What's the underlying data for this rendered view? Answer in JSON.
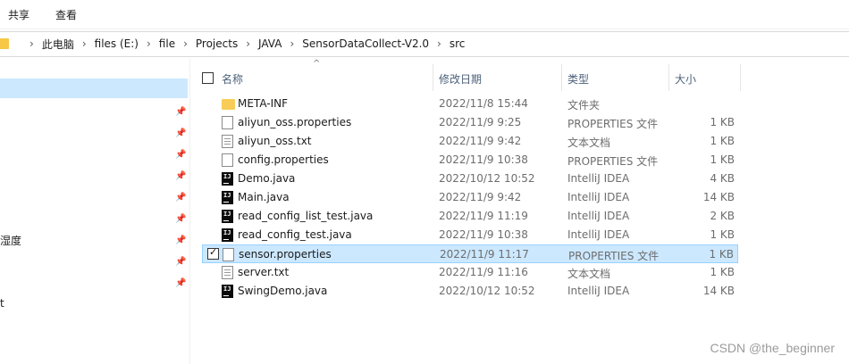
{
  "ribbon": {
    "tabs": [
      {
        "label": "共享"
      },
      {
        "label": "查看"
      }
    ]
  },
  "address": {
    "crumbs": [
      "此电脑",
      "files (E:)",
      "file",
      "Projects",
      "JAVA",
      "SensorDataCollect-V2.0",
      "src"
    ],
    "separator": "›"
  },
  "nav": {
    "labels": [
      {
        "text": "湿度"
      },
      {
        "text": "t"
      }
    ]
  },
  "columns": {
    "name": "名称",
    "date": "修改日期",
    "type": "类型",
    "size": "大小"
  },
  "files": [
    {
      "name": "META-INF",
      "date": "2022/11/8 15:44",
      "type": "文件夹",
      "size": "",
      "icon": "folder-icon"
    },
    {
      "name": "aliyun_oss.properties",
      "date": "2022/11/9 9:25",
      "type": "PROPERTIES 文件",
      "size": "1 KB",
      "icon": "file-icon"
    },
    {
      "name": "aliyun_oss.txt",
      "date": "2022/11/9 9:42",
      "type": "文本文档",
      "size": "1 KB",
      "icon": "text-file-icon"
    },
    {
      "name": "config.properties",
      "date": "2022/11/9 10:38",
      "type": "PROPERTIES 文件",
      "size": "1 KB",
      "icon": "file-icon"
    },
    {
      "name": "Demo.java",
      "date": "2022/10/12 10:52",
      "type": "IntelliJ IDEA",
      "size": "4 KB",
      "icon": "intellij-icon"
    },
    {
      "name": "Main.java",
      "date": "2022/11/9 9:42",
      "type": "IntelliJ IDEA",
      "size": "14 KB",
      "icon": "intellij-icon"
    },
    {
      "name": "read_config_list_test.java",
      "date": "2022/11/9 11:19",
      "type": "IntelliJ IDEA",
      "size": "2 KB",
      "icon": "intellij-icon"
    },
    {
      "name": "read_config_test.java",
      "date": "2022/11/9 10:38",
      "type": "IntelliJ IDEA",
      "size": "1 KB",
      "icon": "intellij-icon"
    },
    {
      "name": "sensor.properties",
      "date": "2022/11/9 11:17",
      "type": "PROPERTIES 文件",
      "size": "1 KB",
      "icon": "file-icon",
      "selected": true
    },
    {
      "name": "server.txt",
      "date": "2022/11/9 11:16",
      "type": "文本文档",
      "size": "1 KB",
      "icon": "text-file-icon"
    },
    {
      "name": "SwingDemo.java",
      "date": "2022/10/12 10:52",
      "type": "IntelliJ IDEA",
      "size": "14 KB",
      "icon": "intellij-icon"
    }
  ],
  "watermark": "CSDN @the_beginner"
}
